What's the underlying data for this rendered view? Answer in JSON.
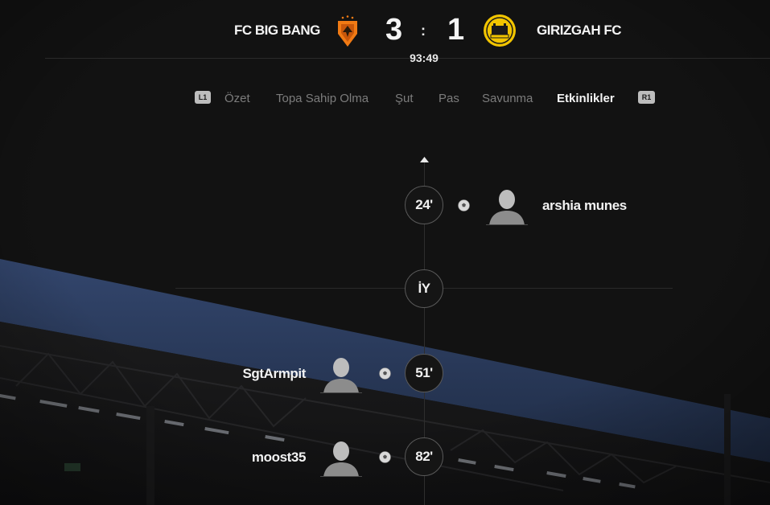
{
  "match": {
    "home_team": "FC BIG BANG",
    "away_team": "GIRIZGAH FC",
    "home_score": "3",
    "separator": ":",
    "away_score": "1",
    "clock": "93:49"
  },
  "tabs": {
    "left_button": "L1",
    "right_button": "R1",
    "items": [
      {
        "label": "Özet",
        "active": false
      },
      {
        "label": "Topa Sahip Olma",
        "active": false
      },
      {
        "label": "Şut",
        "active": false
      },
      {
        "label": "Pas",
        "active": false
      },
      {
        "label": "Savunma",
        "active": false
      },
      {
        "label": "Etkinlikler",
        "active": true
      }
    ]
  },
  "timeline": {
    "events": [
      {
        "minute": "24'",
        "side": "away",
        "type": "goal",
        "player": "arshia munes"
      },
      {
        "minute": "İY",
        "side": "center",
        "type": "half-time"
      },
      {
        "minute": "51'",
        "side": "home",
        "type": "goal",
        "player": "SgtArmpit"
      },
      {
        "minute": "82'",
        "side": "home",
        "type": "goal",
        "player": "moost35"
      }
    ]
  },
  "icons": {
    "home_crest": "shield-crest-icon",
    "away_crest": "round-crest-icon",
    "goal": "soccer-ball-icon",
    "player": "player-silhouette-icon",
    "scroll_up": "triangle-up-icon"
  },
  "colors": {
    "home_crest": "#f07a14",
    "away_crest": "#f2c500",
    "active_tab": "#f4f4f4",
    "inactive_tab": "#7c7c7c",
    "stadium_blue": "#2c3f63"
  }
}
